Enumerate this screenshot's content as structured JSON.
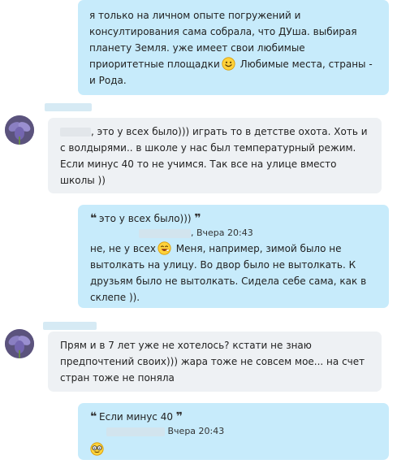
{
  "messages": [
    {
      "text_1": "я только на личном опыте погружений и консултирования сама собрала, что ДУша. выбирая планету Земля. уже имеет свои любимые приоритетные площадки",
      "text_2": " Любимые места, страны - и Рода."
    },
    {
      "text": ", это у всех было))) играть то в детстве охота. Хоть и с волдырями.. в школе у нас был температурный режим. Если минус 40 то не учимся. Так все на улице вместо школы ))"
    },
    {
      "quote_open": "❝",
      "quote_text": "это у всех было)))",
      "quote_close": "❞",
      "quote_time": ", Вчера 20:43",
      "text_1": "не, не у всех",
      "text_2": " Меня, например, зимой было не вытолкать на улицу. Во двор было не вытолкать. К друзьям было не вытолкать. Сидела себе сама, как в склепе ))."
    },
    {
      "text": "Прям и в 7 лет уже не хотелось? кстати не знаю предпочтений своих))) жара тоже не совсем мое... на счет стран тоже не поняла"
    },
    {
      "quote_open": "❝",
      "quote_text": "Если минус 40",
      "quote_close": "❞",
      "quote_time": "Вчера 20:43"
    }
  ],
  "colors": {
    "outgoing_bubble": "#c7ebfb",
    "incoming_bubble": "#eef1f4"
  }
}
